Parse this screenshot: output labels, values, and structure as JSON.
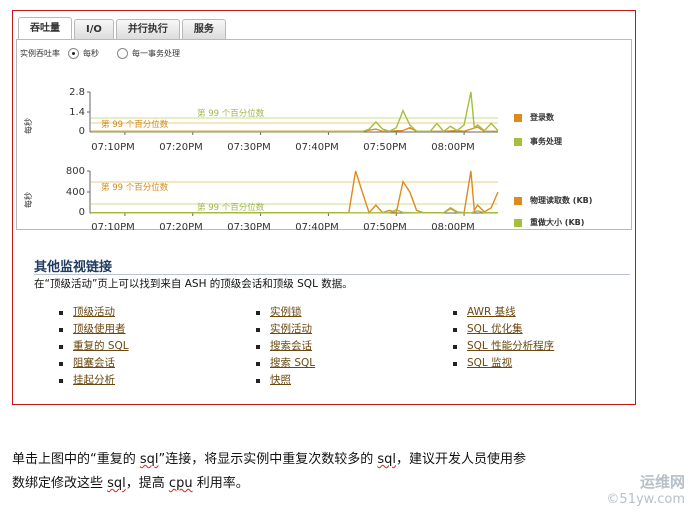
{
  "tabs": [
    "吞吐量",
    "I/O",
    "并行执行",
    "服务"
  ],
  "rate": {
    "label": "实例吞吐率",
    "options": [
      "每秒",
      "每一事务处理"
    ],
    "selected": 0
  },
  "time_labels": [
    "07:10PM",
    "07:20PM",
    "07:30PM",
    "07:40PM",
    "07:50PM",
    "08:00PM"
  ],
  "chart1": {
    "ylabel": "每秒",
    "ticks": [
      "2.8",
      "1.4",
      "0"
    ],
    "pct_label": "第 99 个百分位数",
    "legend": [
      "登录数",
      "事务处理"
    ],
    "colors": [
      "#e08a1e",
      "#a3bf3e"
    ]
  },
  "chart2": {
    "ylabel": "每秒",
    "ticks": [
      "800",
      "400",
      "0"
    ],
    "pct_label": "第 99 个百分位数",
    "legend": [
      "物理读取数 (KB)",
      "重做大小 (KB)"
    ],
    "colors": [
      "#e08a1e",
      "#a3bf3e"
    ]
  },
  "chart_data": [
    {
      "type": "line",
      "ylabel": "每秒",
      "ylim": [
        0,
        2.8
      ],
      "x": [
        "07:10PM",
        "07:20PM",
        "07:30PM",
        "07:40PM",
        "07:50PM",
        "08:00PM"
      ],
      "reference_lines": [
        {
          "label": "第 99 个百分位数",
          "series": "登录数",
          "y": 0.6
        },
        {
          "label": "第 99 个百分位数",
          "series": "事务处理",
          "y": 1.0
        }
      ],
      "series": [
        {
          "name": "登录数",
          "color": "#e08a1e",
          "points": [
            [
              0,
              0.05
            ],
            [
              40,
              0.05
            ],
            [
              42,
              0.2
            ],
            [
              43,
              0.05
            ],
            [
              46,
              0.1
            ],
            [
              47,
              0.3
            ],
            [
              48,
              0.05
            ],
            [
              52,
              0.05
            ],
            [
              54,
              0.1
            ],
            [
              55,
              0.05
            ],
            [
              57,
              0.35
            ],
            [
              58,
              0.05
            ],
            [
              60,
              0.05
            ]
          ]
        },
        {
          "name": "事务处理",
          "color": "#a3bf3e",
          "points": [
            [
              0,
              0.03
            ],
            [
              40,
              0.03
            ],
            [
              41,
              0.2
            ],
            [
              42,
              0.7
            ],
            [
              43,
              0.2
            ],
            [
              44,
              0.05
            ],
            [
              45,
              0.3
            ],
            [
              46,
              1.5
            ],
            [
              47,
              0.5
            ],
            [
              48,
              0.05
            ],
            [
              50,
              0.05
            ],
            [
              51,
              0.6
            ],
            [
              52,
              0.05
            ],
            [
              53,
              0.4
            ],
            [
              54,
              0.1
            ],
            [
              55,
              0.5
            ],
            [
              56,
              2.8
            ],
            [
              56.5,
              0.3
            ],
            [
              57,
              0.5
            ],
            [
              58,
              0.1
            ],
            [
              59,
              0.6
            ],
            [
              60,
              0.1
            ]
          ]
        }
      ]
    },
    {
      "type": "line",
      "ylabel": "每秒",
      "ylim": [
        0,
        800
      ],
      "x": [
        "07:10PM",
        "07:20PM",
        "07:30PM",
        "07:40PM",
        "07:50PM",
        "08:00PM"
      ],
      "reference_lines": [
        {
          "label": "第 99 个百分位数",
          "series": "物理读取数 (KB)",
          "y": 600
        },
        {
          "label": "第 99 个百分位数",
          "series": "重做大小 (KB)",
          "y": 200
        }
      ],
      "series": [
        {
          "name": "物理读取数 (KB)",
          "color": "#e08a1e",
          "points": [
            [
              0,
              5
            ],
            [
              38,
              5
            ],
            [
              39,
              800
            ],
            [
              40,
              400
            ],
            [
              41,
              5
            ],
            [
              42,
              150
            ],
            [
              43,
              5
            ],
            [
              44,
              50
            ],
            [
              45,
              5
            ],
            [
              46,
              600
            ],
            [
              47,
              400
            ],
            [
              48,
              50
            ],
            [
              49,
              5
            ],
            [
              52,
              5
            ],
            [
              53,
              100
            ],
            [
              54,
              20
            ],
            [
              55,
              5
            ],
            [
              56,
              800
            ],
            [
              56.5,
              50
            ],
            [
              57,
              150
            ],
            [
              58,
              20
            ],
            [
              59,
              100
            ],
            [
              60,
              400
            ]
          ]
        },
        {
          "name": "重做大小 (KB)",
          "color": "#a3bf3e",
          "points": [
            [
              0,
              3
            ],
            [
              44,
              3
            ],
            [
              45,
              60
            ],
            [
              46,
              10
            ],
            [
              48,
              3
            ],
            [
              52,
              3
            ],
            [
              53,
              80
            ],
            [
              54,
              10
            ],
            [
              56,
              3
            ],
            [
              57,
              40
            ],
            [
              58,
              5
            ],
            [
              60,
              5
            ]
          ]
        }
      ]
    }
  ],
  "links": {
    "title": "其他监视链接",
    "intro": "在“顶级活动”页上可以找到来自 ASH 的顶级会话和顶级 SQL 数据。",
    "col1": [
      "顶级活动",
      "顶级使用者",
      "重复的 SQL",
      "阻塞会话",
      "挂起分析"
    ],
    "col2": [
      "实例锁",
      "实例活动",
      "搜索会话",
      "搜索 SQL",
      "快照"
    ],
    "col3": [
      "AWR 基线",
      "SQL 优化集",
      "SQL 性能分析程序",
      "SQL 监视"
    ]
  },
  "caption": {
    "l1a": "单击上图中的“重复的 ",
    "l1s1": "sql",
    "l1b": "”连接，将显示实例中重复次数较多的 ",
    "l1s2": "sql",
    "l1c": "，建议开发人员使用参",
    "l2a": "数绑定修改这些 ",
    "l2s1": "sql",
    "l2b": "，提高 ",
    "l2s2": "cpu",
    "l2c": " 利用率。"
  },
  "watermark": {
    "line1": "运维网",
    "line2": "©51yw.com"
  }
}
